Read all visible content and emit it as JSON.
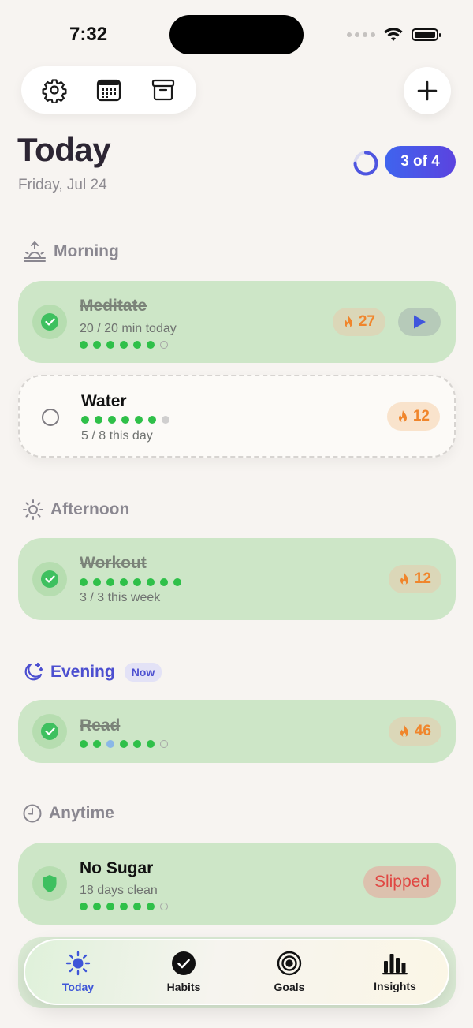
{
  "status": {
    "time": "7:32"
  },
  "header": {
    "title": "Today",
    "date": "Friday, Jul 24",
    "progress_label": "3 of 4",
    "progress_fraction": 0.75
  },
  "sections": {
    "morning": {
      "label": "Morning"
    },
    "afternoon": {
      "label": "Afternoon"
    },
    "evening": {
      "label": "Evening",
      "badge": "Now"
    },
    "anytime": {
      "label": "Anytime"
    }
  },
  "habits": {
    "meditate": {
      "name": "Meditate",
      "detail": "20 / 20 min today",
      "streak": "27"
    },
    "water": {
      "name": "Water",
      "detail": "5 / 8 this day",
      "streak": "12"
    },
    "workout": {
      "name": "Workout",
      "detail": "3 / 3 this week",
      "streak": "12"
    },
    "read": {
      "name": "Read",
      "streak": "46"
    },
    "nosugar": {
      "name": "No Sugar",
      "detail": "18 days clean",
      "status": "Slipped"
    }
  },
  "tabs": {
    "today": "Today",
    "habits": "Habits",
    "goals": "Goals",
    "insights": "Insights"
  },
  "colors": {
    "accent": "#3f64ee",
    "done_card": "#cde6c7",
    "streak": "#f0852b",
    "check": "#3ec05f",
    "slipped": "#e04743"
  },
  "icons": [
    "gear-icon",
    "calendar-icon",
    "archive-icon",
    "plus-icon",
    "sunrise-icon",
    "sun-icon",
    "moon-icon",
    "clock-icon",
    "flame-icon",
    "play-icon",
    "shield-icon"
  ]
}
